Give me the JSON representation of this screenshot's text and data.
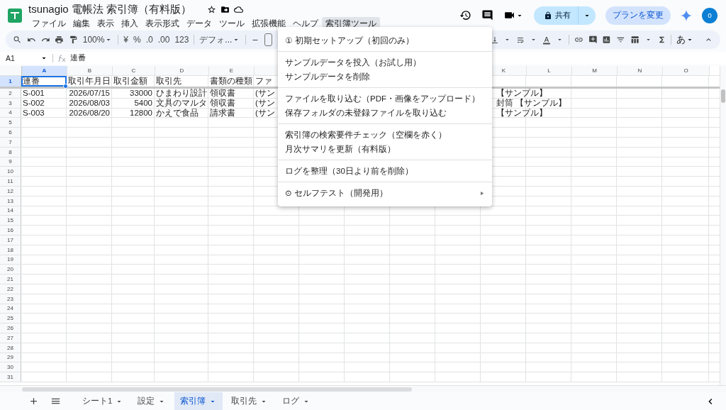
{
  "window": {
    "title": "tsunagio 電帳法 索引簿（有料版）"
  },
  "menu_bar": [
    {
      "label": "ファイル",
      "selected": false
    },
    {
      "label": "編集",
      "selected": false
    },
    {
      "label": "表示",
      "selected": false
    },
    {
      "label": "挿入",
      "selected": false
    },
    {
      "label": "表示形式",
      "selected": false
    },
    {
      "label": "データ",
      "selected": false
    },
    {
      "label": "ツール",
      "selected": false
    },
    {
      "label": "拡張機能",
      "selected": false
    },
    {
      "label": "ヘルプ",
      "selected": false
    },
    {
      "label": "索引簿ツール",
      "selected": true
    }
  ],
  "account": {
    "share": "共有",
    "upgrade": "プランを変更",
    "avatar": "o"
  },
  "toolbar": {
    "zoom": "100%",
    "currency": "¥",
    "percent": "%",
    "decrease_decimal": ".0",
    "increase_decimal": ".00",
    "number_format": "123",
    "font": "デフォ...",
    "input_mode": "あ"
  },
  "formula_bar": {
    "cell": "A1",
    "content": "連番"
  },
  "columns": [
    {
      "label": "A",
      "selected": true
    },
    {
      "label": "B",
      "selected": false
    },
    {
      "label": "C",
      "selected": false
    },
    {
      "label": "D",
      "selected": false
    },
    {
      "label": "E",
      "selected": false
    },
    {
      "label": "K",
      "selected": false
    },
    {
      "label": "L",
      "selected": false
    },
    {
      "label": "M",
      "selected": false
    },
    {
      "label": "N",
      "selected": false
    },
    {
      "label": "O",
      "selected": false
    }
  ],
  "rows": [
    {
      "number": "1",
      "selected": true,
      "cells": [
        "連番",
        "取引年月日",
        "取引金額",
        "取引先",
        "書類の種類",
        "ファ"
      ]
    },
    {
      "number": "2",
      "selected": false,
      "cells": [
        "S-001",
        {
          "text": "2026/07/15",
          "kind": "number"
        },
        {
          "text": "33000",
          "kind": "number"
        },
        "ひまわり設計",
        "領収書",
        "(サン"
      ],
      "overflow": "【サンプル】"
    },
    {
      "number": "3",
      "selected": false,
      "cells": [
        "S-002",
        {
          "text": "2026/08/03",
          "kind": "number"
        },
        {
          "text": "5400",
          "kind": "number"
        },
        "文具のマルタ",
        "領収書",
        "(サン"
      ],
      "overflow": "封筒 【サンプル】"
    },
    {
      "number": "4",
      "selected": false,
      "cells": [
        "S-003",
        {
          "text": "2026/08/20",
          "kind": "number"
        },
        {
          "text": "12800",
          "kind": "number"
        },
        "かえで食品",
        "請求書",
        "(サン"
      ],
      "overflow": "【サンプル】"
    }
  ],
  "empty_rows": [
    "5",
    "6",
    "7",
    "8",
    "9",
    "10",
    "11",
    "12",
    "13",
    "14",
    "15",
    "16",
    "17",
    "18",
    "19",
    "20",
    "21",
    "22",
    "23",
    "24",
    "25",
    "26",
    "27",
    "28",
    "29",
    "30",
    "31"
  ],
  "dropdown_menu": {
    "groups": [
      [
        {
          "label": "① 初期セットアップ（初回のみ）",
          "submenu": false
        }
      ],
      [
        {
          "label": "サンプルデータを投入（お試し用）",
          "submenu": false
        },
        {
          "label": "サンプルデータを削除",
          "submenu": false
        }
      ],
      [
        {
          "label": "ファイルを取り込む（PDF・画像をアップロード）",
          "submenu": false
        },
        {
          "label": "保存フォルダの未登録ファイルを取り込む",
          "submenu": false
        }
      ],
      [
        {
          "label": "索引簿の検索要件チェック（空欄を赤く）",
          "submenu": false
        },
        {
          "label": "月次サマリを更新（有料版）",
          "submenu": false
        }
      ],
      [
        {
          "label": "ログを整理（30日より前を削除）",
          "submenu": false
        }
      ],
      [
        {
          "label": "⊙ セルフテスト（開発用）",
          "submenu": true
        }
      ]
    ]
  },
  "sheet_tabs": [
    {
      "label": "シート1",
      "selected": false
    },
    {
      "label": "設定",
      "selected": false
    },
    {
      "label": "索引簿",
      "selected": true
    },
    {
      "label": "取引先",
      "selected": false
    },
    {
      "label": "ログ",
      "selected": false
    }
  ]
}
